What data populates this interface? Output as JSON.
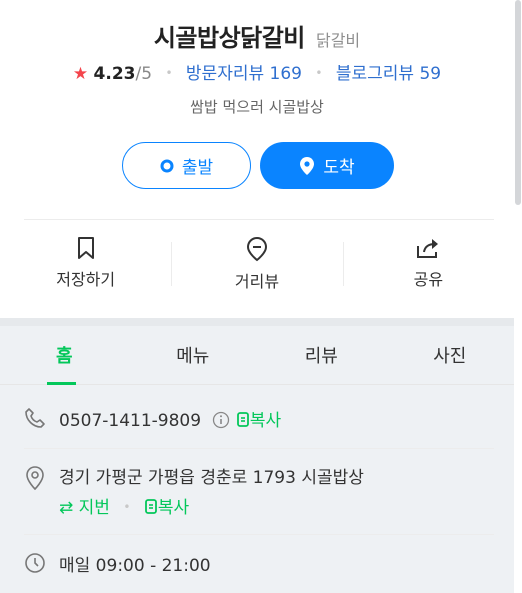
{
  "place": {
    "name": "시골밥상닭갈비",
    "category": "닭갈비",
    "rating": "4.23",
    "rating_max": "/5",
    "visitor_reviews_label": "방문자리뷰",
    "visitor_reviews_count": "169",
    "blog_reviews_label": "블로그리뷰",
    "blog_reviews_count": "59",
    "description": "쌈밥 먹으러 시골밥상"
  },
  "route": {
    "start_label": "출발",
    "arrive_label": "도착"
  },
  "actions": {
    "save_label": "저장하기",
    "street_view_label": "거리뷰",
    "share_label": "공유"
  },
  "tabs": [
    {
      "label": "홈",
      "active": true
    },
    {
      "label": "메뉴",
      "active": false
    },
    {
      "label": "리뷰",
      "active": false
    },
    {
      "label": "사진",
      "active": false
    }
  ],
  "info": {
    "phone": "0507-1411-9809",
    "copy_label": "복사",
    "address": "경기 가평군 가평읍 경춘로 1793 시골밥상",
    "lot_number_label": "지번",
    "hours": "매일 09:00 - 21:00"
  },
  "colors": {
    "accent_blue": "#0a84ff",
    "link_blue": "#2f6fcf",
    "green": "#03c75a",
    "star_red": "#f4454c"
  }
}
